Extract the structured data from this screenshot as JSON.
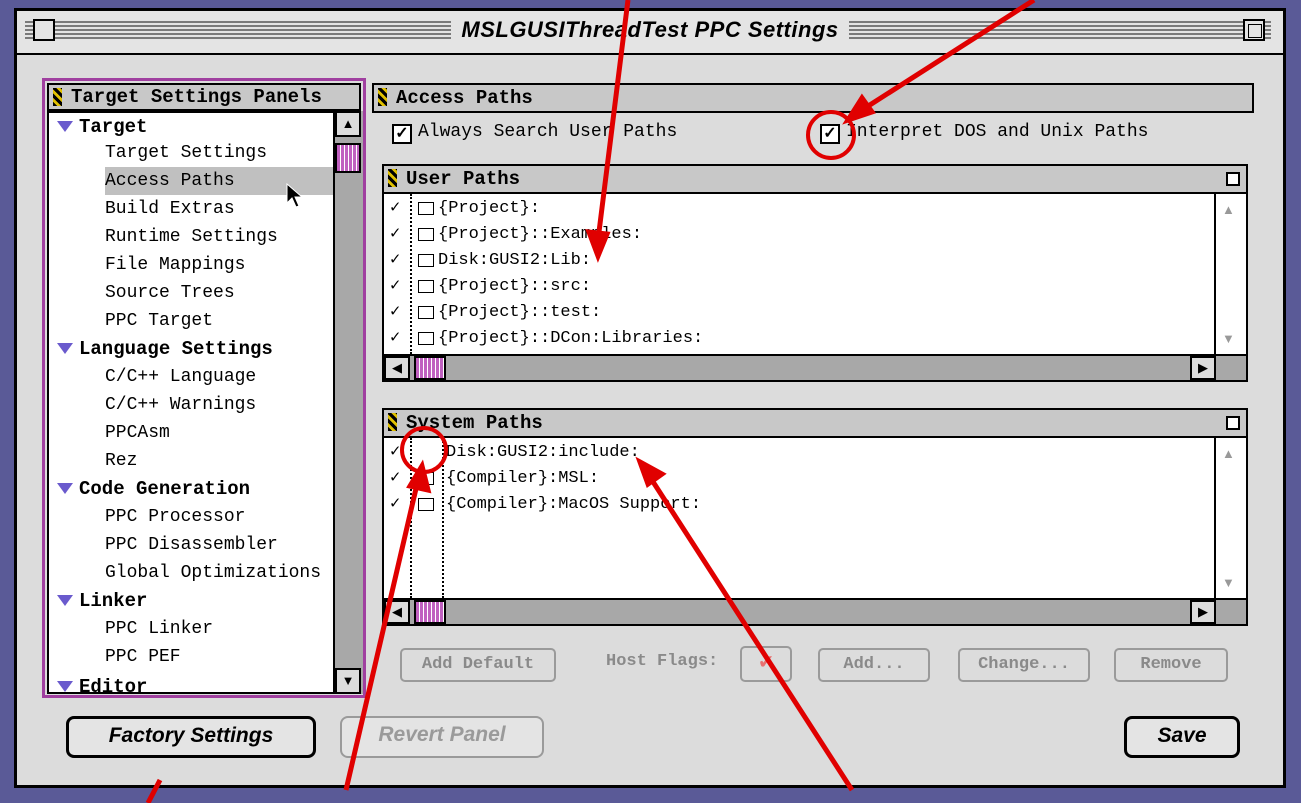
{
  "window": {
    "title": "MSLGUSIThreadTest PPC Settings"
  },
  "sidebar": {
    "header": "Target Settings Panels",
    "groups": [
      {
        "label": "Target",
        "items": [
          "Target Settings",
          "Access Paths",
          "Build Extras",
          "Runtime Settings",
          "File Mappings",
          "Source Trees",
          "PPC Target"
        ]
      },
      {
        "label": "Language Settings",
        "items": [
          "C/C++ Language",
          "C/C++ Warnings",
          "PPCAsm",
          "Rez"
        ]
      },
      {
        "label": "Code Generation",
        "items": [
          "PPC Processor",
          "PPC Disassembler",
          "Global Optimizations"
        ]
      },
      {
        "label": "Linker",
        "items": [
          "PPC Linker",
          "PPC PEF"
        ]
      },
      {
        "label": "Editor",
        "items": []
      }
    ],
    "selected": "Access Paths"
  },
  "main": {
    "header": "Access Paths",
    "always_search_label": "Always Search User Paths",
    "interpret_label": "Interpret DOS and Unix Paths",
    "user_paths": {
      "title": "User Paths",
      "rows": [
        "{Project}:",
        "{Project}::Examples:",
        "Disk:GUSI2:Lib:",
        "{Project}::src:",
        "{Project}::test:",
        "{Project}::DCon:Libraries:"
      ]
    },
    "system_paths": {
      "title": "System Paths",
      "rows": [
        "Disk:GUSI2:include:",
        "{Compiler}:MSL:",
        "{Compiler}:MacOS Support:"
      ]
    },
    "buttons": {
      "add_default": "Add Default",
      "host_flags": "Host Flags:",
      "add": "Add...",
      "change": "Change...",
      "remove": "Remove"
    }
  },
  "footer": {
    "factory_settings": "Factory Settings",
    "revert_panel": "Revert Panel",
    "save": "Save"
  },
  "colors": {
    "accent": "#c060c0",
    "annotation": "#e00000",
    "desktop": "#5a5a97"
  }
}
